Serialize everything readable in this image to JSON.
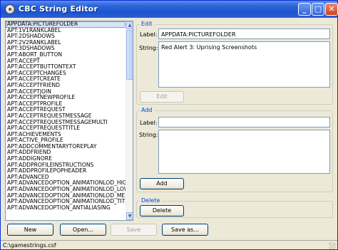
{
  "window": {
    "title": "CBC String Editor"
  },
  "titlebar_buttons": {
    "minimize": "_",
    "maximize": "□",
    "close": "✕"
  },
  "list": {
    "items": [
      "APPDATA:PICTUREFOLDER",
      "APT:1V1RANKLABEL",
      "APT:2DSHADOWS",
      "APT:2V2RANKLABEL",
      "APT:3DSHADOWS",
      "APT:ABORT_BUTTON",
      "APT:ACCEPT",
      "APT:ACCEPTBUTTONTEXT",
      "APT:ACCEPTCHANGES",
      "APT:ACCEPTCREATE",
      "APT:ACCEPTFRIEND",
      "APT:ACCEPTJOIN",
      "APT:ACCEPTNEWPROFILE",
      "APT:ACCEPTPROFILE",
      "APT:ACCEPTREQUEST",
      "APT:ACCEPTREQUESTMESSAGE",
      "APT:ACCEPTREQUESTMESSAGEMULTI",
      "APT:ACCEPTREQUESTTITLE",
      "APT:ACHIEVEMENTS",
      "APT:ACTIVE_PROFILE",
      "APT:ADDCOMMENTARYTOREPLAY",
      "APT:ADDFRIEND",
      "APT:ADDIGNORE",
      "APT:ADDPROFILEINSTRUCTIONS",
      "APT:ADDPROFILEPOPHEADER",
      "APT:ADVANCED",
      "APT:ADVANCEDOPTION_ANIMATIONLOD_HIGH",
      "APT:ADVANCEDOPTION_ANIMATIONLOD_LOW",
      "APT:ADVANCEDOPTION_ANIMATIONLOD_MEDIUM",
      "APT:ADVANCEDOPTION_ANIMATIONLOD_TITLE",
      "APT:ADVANCEDOPTION_ANTIALIASING"
    ],
    "selected_index": 0
  },
  "edit": {
    "legend": "Edit",
    "label_caption": "Label:",
    "label_value": "APPDATA:PICTUREFOLDER",
    "string_caption": "String:",
    "string_value": "Red Alert 3: Uprising Screenshots",
    "button": "Edit"
  },
  "add": {
    "legend": "Add",
    "label_caption": "Label:",
    "label_value": "",
    "string_caption": "String:",
    "string_value": "",
    "button": "Add"
  },
  "delete": {
    "legend": "Delete",
    "button": "Delete"
  },
  "toolbar": {
    "new": "New",
    "open": "Open...",
    "save": "Save",
    "save_as": "Save as..."
  },
  "status": {
    "path": "C:\\gamestrings.csf"
  }
}
